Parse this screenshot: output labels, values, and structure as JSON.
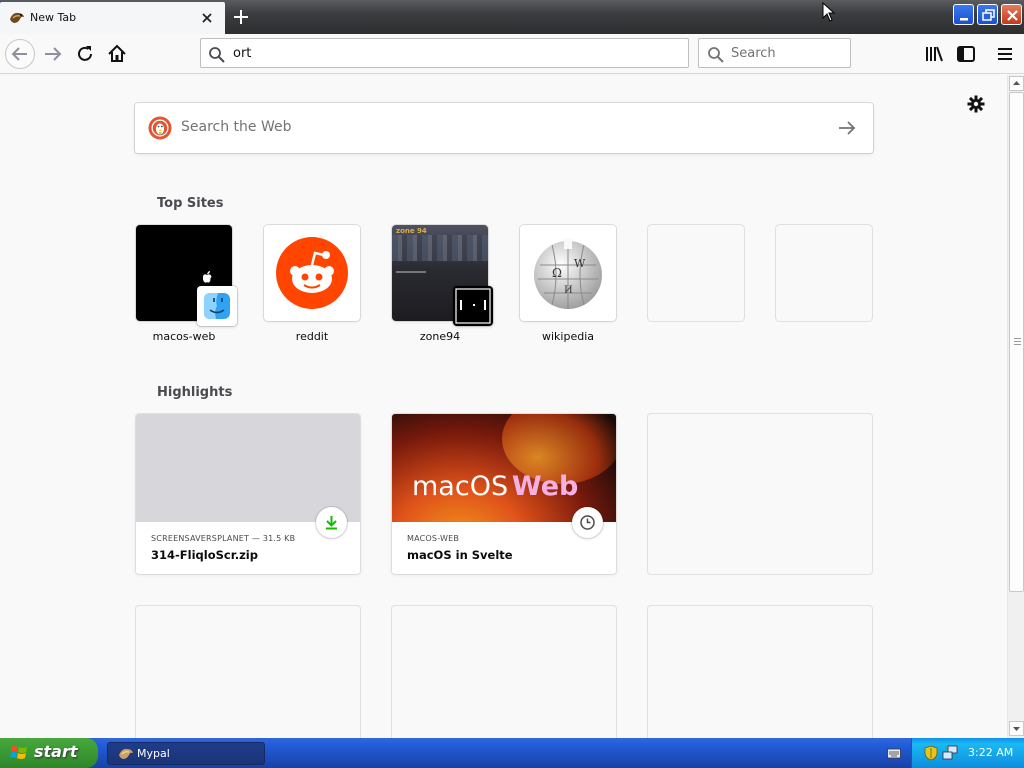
{
  "browser": {
    "tab": {
      "title": "New Tab"
    },
    "urlbar": {
      "value": "ort"
    },
    "searchbar": {
      "placeholder": "Search"
    }
  },
  "newtab": {
    "websearch": {
      "placeholder": "Search the Web"
    },
    "top_sites": {
      "heading": "Top Sites",
      "items": [
        {
          "label": "macos-web"
        },
        {
          "label": "reddit"
        },
        {
          "label": "zone94",
          "thumb_text": "zone 94"
        },
        {
          "label": "wikipedia"
        }
      ]
    },
    "highlights": {
      "heading": "Highlights",
      "items": [
        {
          "source": "SCREENSAVERSPLANET — 31.5 KB",
          "title": "314-FliqloScr.zip",
          "badge_icon": "download-icon"
        },
        {
          "source": "MACOS-WEB",
          "title": "macOS in Svelte",
          "image_text": "macOS",
          "image_text_accent": "Web",
          "badge_icon": "clock-icon"
        }
      ]
    }
  },
  "taskbar": {
    "start_label": "start",
    "task_label": "Mypal",
    "clock": "3:22 AM"
  },
  "colors": {
    "titlebar": "#2d2e30",
    "taskbar_blue": "#245edb",
    "start_green": "#3c9a34",
    "reddit_orange": "#ff4500",
    "ddg_orange": "#de5833",
    "download_green": "#12bc00"
  }
}
